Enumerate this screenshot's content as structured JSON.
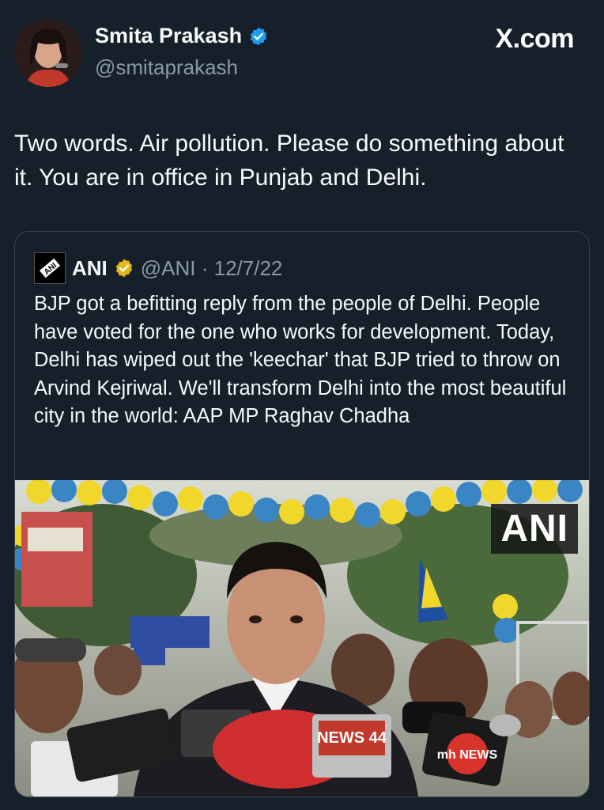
{
  "header": {
    "author_name": "Smita Prakash",
    "author_handle": "@smitaprakash",
    "brand": "X.com"
  },
  "tweet": {
    "text": "Two words. Air pollution. Please do something about it. You are in office in Punjab and Delhi."
  },
  "quote": {
    "author_name": "ANI",
    "meta": "@ANI · 12/7/22",
    "text": "BJP got a befitting reply from the people of Delhi. People have voted for the one who works for development. Today, Delhi has wiped out the 'keechar' that BJP tried to throw on Arvind Kejriwal. We'll transform Delhi into the most beautiful city in the world: AAP MP Raghav Chadha",
    "media_badge": "ANI",
    "mic_labels": [
      "NEWS 44",
      "mh NEWS"
    ]
  },
  "colors": {
    "background": "#15202b",
    "border": "#38444d",
    "secondary_text": "#8b98a5",
    "verified_blue": "#1d9bf0",
    "verified_gold": "#e2b719"
  },
  "icons": {
    "author_verified": "verified-blue-badge-icon",
    "quote_verified": "verified-gold-badge-icon",
    "quote_logo": "ani-logo-icon"
  }
}
